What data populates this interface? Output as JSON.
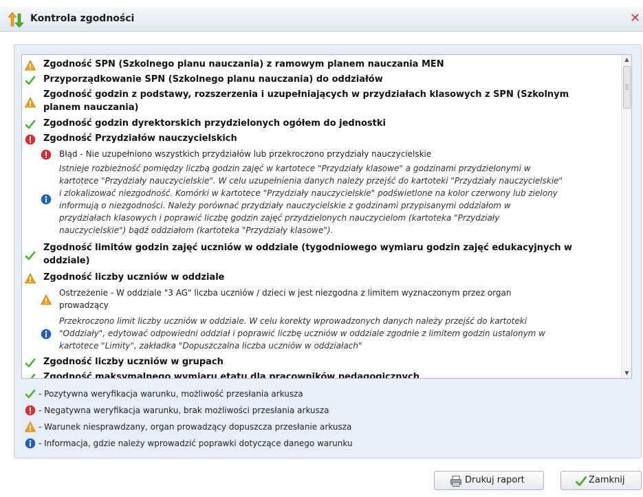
{
  "window": {
    "title": "Kontrola zgodności",
    "close_symbol": "✕"
  },
  "checks": {
    "h1": "Zgodność SPN (Szkolnego planu nauczania) z ramowym planem nauczania MEN",
    "h2": "Przyporządkowanie SPN (Szkolnego planu nauczania) do oddziałów",
    "h3_line1": "Zgodność godzin z podstawy, rozszerzenia i uzupełniających w przydziałach klasowych z SPN (Szkolnym",
    "h3_line2": "planem nauczania)",
    "h4": "Zgodność godzin dyrektorskich przydzielonych ogółem do jednostki",
    "h5": "Zgodność Przydziałów nauczycielskich",
    "h5_error": "Błąd - Nie uzupełniono wszystkich przydziałów lub przekroczono przydziały nauczycielskie",
    "h5_info": [
      "Istnieje rozbieżność pomiędzy liczbą godzin zajęć w kartotece \"Przydziały klasowe\" a godzinami przydzielonymi w",
      "kartotece \"Przydziały nauczycielskie\". W celu uzupełnienia danych należy przejść do kartoteki \"Przydziały nauczycielskie\"",
      "i zlokalizować niezgodność. Komórki w kartotece \"Przydziały nauczycielskie\" podświetlone na kolor czerwony lub zielony",
      "informują o niezgodności. Należy porównać przydziały nauczycielskie z godzinami przypisanymi oddziałom w",
      "przydziałach klasowych i poprawić liczbę godzin zajęć przydzielonych nauczycielom (kartoteka \"Przydziały",
      "nauczycielskie\") bądź oddziałom (kartoteka \"Przydziały klasowe\")."
    ],
    "h6_line1": "Zgodność limitów godzin zajęć uczniów w oddziale (tygodniowego wymiaru godzin zajęć edukacyjnych w",
    "h6_line2": "oddziale)",
    "h7": "Zgodność liczby uczniów w oddziale",
    "h7_warn_line1": "Ostrzeżenie - W oddziale \"3 AG\" liczba uczniów / dzieci w jest niezgodna z limitem wyznaczonym przez organ",
    "h7_warn_line2": "prowadzący",
    "h7_info": [
      "Przekroczono limit liczby uczniów w oddziale. W celu korekty wprowadzonych danych należy przejść do kartoteki",
      "\"Oddziały\", edytować odpowiedni oddział i poprawić liczbę uczniów w oddziale zgodnie z limitem godzin ustalonym w",
      "kartotece \"Limity\", zakładka \"Dopuszczalna liczba uczniów w oddziałach\""
    ],
    "h8": "Zgodność liczby uczniów w grupach",
    "h9": "Zgodność maksymalnego wymiaru etatu dla pracowników pedagogicznych"
  },
  "legend": {
    "positive": "- Pozytywna weryfikacja warunku, możliwość przesłania arkusza",
    "negative": "- Negatywna weryfikacja warunku, brak możliwości przesłania arkusza",
    "warning": "- Warunek niesprawdzany, organ prowadzący dopuszcza przesłanie arkusza",
    "info": "- Informacja, gdzie należy wprowadzić poprawki dotyczące danego warunku"
  },
  "buttons": {
    "print": "Drukuj raport",
    "close": "Zamknij"
  },
  "colors": {
    "ok": "#4caf2a",
    "error": "#d32f2f",
    "warning": "#f0a020",
    "info": "#1f5fb8"
  }
}
